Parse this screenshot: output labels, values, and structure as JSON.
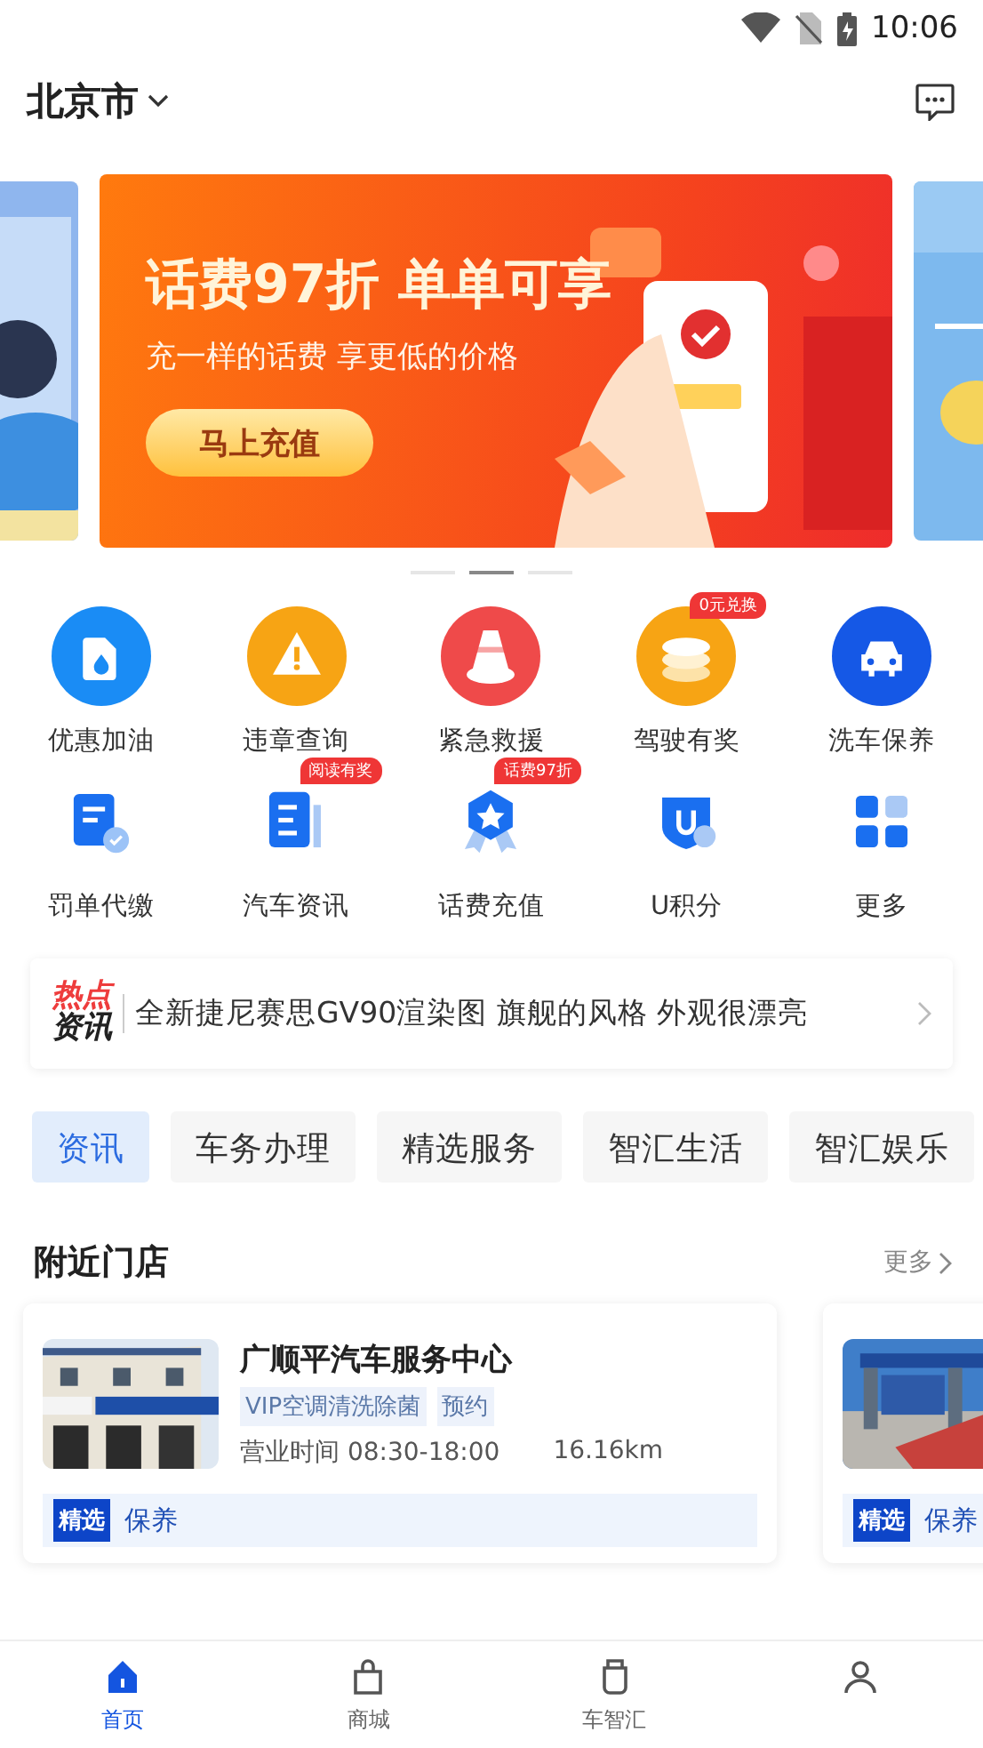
{
  "status_bar": {
    "time": "10:06"
  },
  "header": {
    "city": "北京市"
  },
  "banner": {
    "title": "话费97折 单单可享",
    "subtitle": "充一样的话费 享更低的价格",
    "button": "马上充值",
    "pages": [
      {
        "selected": false
      },
      {
        "selected": true
      },
      {
        "selected": false
      }
    ]
  },
  "services": [
    {
      "label": "优惠加油",
      "kind": "fuel",
      "color": "#1a8cf5"
    },
    {
      "label": "违章查询",
      "kind": "warning",
      "color": "#f7a414"
    },
    {
      "label": "紧急救援",
      "kind": "sos",
      "color": "#ef4a4a"
    },
    {
      "label": "驾驶有奖",
      "kind": "coins",
      "color": "#f7a414",
      "badge": "0元兑换"
    },
    {
      "label": "洗车保养",
      "kind": "car",
      "color": "#1558e6"
    },
    {
      "label": "罚单代缴",
      "kind": "ticket"
    },
    {
      "label": "汽车资讯",
      "kind": "news",
      "badge": "阅读有奖"
    },
    {
      "label": "话费充值",
      "kind": "medal",
      "badge": "话费97折"
    },
    {
      "label": "U积分",
      "kind": "shield"
    },
    {
      "label": "更多",
      "kind": "grid"
    }
  ],
  "hot_news": {
    "tag_top": "热点",
    "tag_bottom": "资讯",
    "headline": "全新捷尼赛思GV90渲染图 旗舰的风格 外观很漂亮"
  },
  "category_tabs": [
    {
      "label": "资讯",
      "selected": true
    },
    {
      "label": "车务办理",
      "selected": false
    },
    {
      "label": "精选服务",
      "selected": false
    },
    {
      "label": "智汇生活",
      "selected": false
    },
    {
      "label": "智汇娱乐",
      "selected": false
    }
  ],
  "nearby": {
    "title": "附近门店",
    "more": "更多",
    "stores": [
      {
        "name": "广顺平汽车服务中心",
        "tags": [
          "VIP空调清洗除菌",
          "预约"
        ],
        "hours": "营业时间 08:30-18:00",
        "distance": "16.16km",
        "badge": "精选",
        "service": "保养"
      },
      {
        "badge": "精选",
        "service": "保养"
      }
    ]
  },
  "bottom_nav": [
    {
      "label": "首页",
      "kind": "home",
      "selected": true
    },
    {
      "label": "商城",
      "kind": "bag",
      "selected": false
    },
    {
      "label": "车智汇",
      "kind": "cup",
      "selected": false
    },
    {
      "kind": "person",
      "selected": false
    }
  ]
}
